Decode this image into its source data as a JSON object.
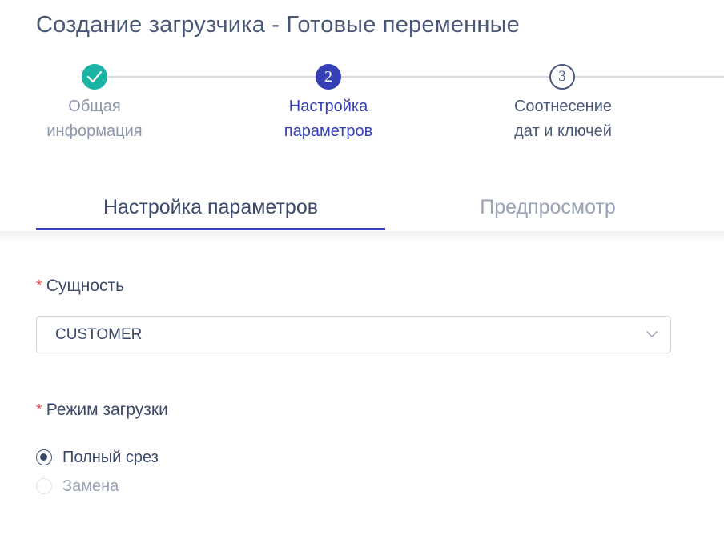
{
  "page": {
    "title": "Создание загрузчика - Готовые переменные"
  },
  "stepper": {
    "steps": [
      {
        "number": "",
        "label_line1": "Общая",
        "label_line2": "информация",
        "state": "done",
        "icon": "check-icon"
      },
      {
        "number": "2",
        "label_line1": "Настройка",
        "label_line2": "параметров",
        "state": "active"
      },
      {
        "number": "3",
        "label_line1": "Соотнесение",
        "label_line2": "дат и ключей",
        "state": "todo"
      }
    ]
  },
  "tabs": [
    {
      "label": "Настройка параметров",
      "active": true
    },
    {
      "label": "Предпросмотр",
      "active": false
    }
  ],
  "form": {
    "entity": {
      "required_mark": "*",
      "label": "Сущность",
      "value": "CUSTOMER"
    },
    "load_mode": {
      "required_mark": "*",
      "label": "Режим загрузки",
      "options": [
        {
          "label": "Полный срез",
          "selected": true
        },
        {
          "label": "Замена",
          "selected": false
        }
      ]
    }
  },
  "colors": {
    "accent": "#3540b5",
    "done": "#1bb3a3",
    "required": "#e05656"
  }
}
